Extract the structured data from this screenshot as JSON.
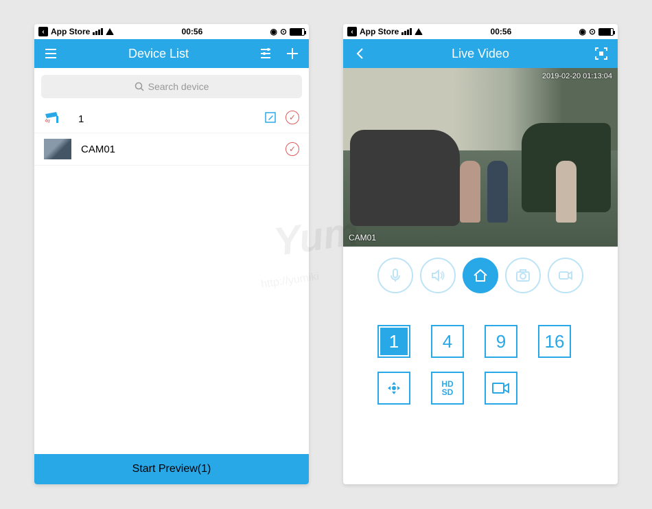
{
  "statusbar": {
    "app_label": "App Store",
    "time": "00:56"
  },
  "left": {
    "title": "Device List",
    "search_placeholder": "Search device",
    "device_group": "1",
    "camera_name": "CAM01",
    "start_button": "Start Preview(1)"
  },
  "right": {
    "title": "Live Video",
    "timestamp": "2019-02-20 01:13:04",
    "camera_label": "CAM01",
    "grid_options": [
      "1",
      "4",
      "9",
      "16"
    ],
    "hdsd_label": "HD\nSD"
  },
  "watermark": "Yum",
  "watermark_url": "http://yumiki"
}
